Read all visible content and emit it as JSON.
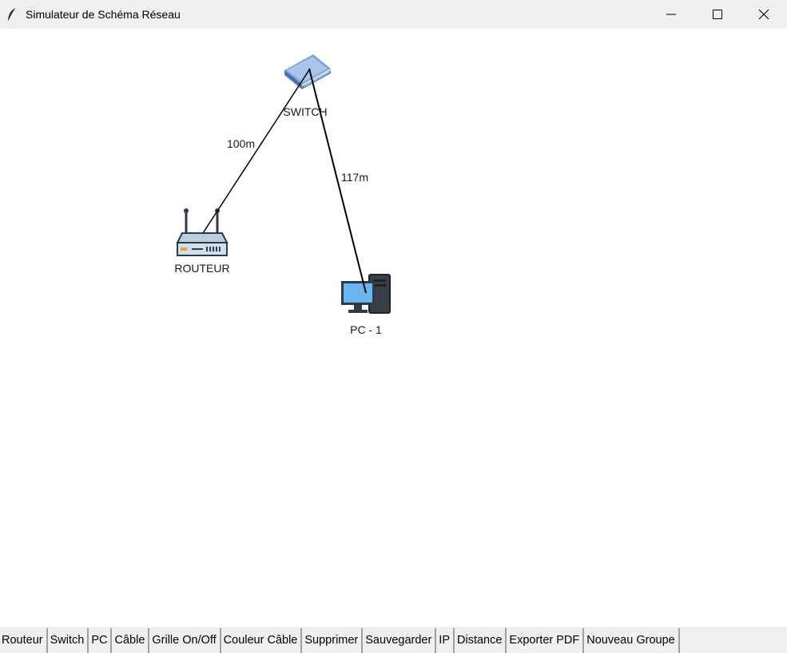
{
  "window": {
    "title": "Simulateur de Schéma Réseau",
    "icon": "feather-icon",
    "controls": [
      "minimize-icon",
      "maximize-icon",
      "close-icon"
    ]
  },
  "canvas": {
    "background": "#ffffff",
    "cable_color": "#000000",
    "nodes": [
      {
        "id": "switch",
        "type": "switch",
        "label": "SWITCH",
        "icon": "switch-icon"
      },
      {
        "id": "router",
        "type": "router",
        "label": "ROUTEUR",
        "icon": "router-icon"
      },
      {
        "id": "pc1",
        "type": "pc",
        "label": "PC - 1",
        "icon": "computer-icon"
      }
    ],
    "cables": [
      {
        "from": "router",
        "to": "switch",
        "distance_label": "100m"
      },
      {
        "from": "switch",
        "to": "pc1",
        "distance_label": "117m"
      }
    ]
  },
  "toolbar": {
    "buttons": [
      "Routeur",
      "Switch",
      "PC",
      "Câble",
      "Grille On/Off",
      "Couleur Câble",
      "Supprimer",
      "Sauvegarder",
      "IP",
      "Distance",
      "Exporter PDF",
      "Nouveau Groupe"
    ]
  }
}
